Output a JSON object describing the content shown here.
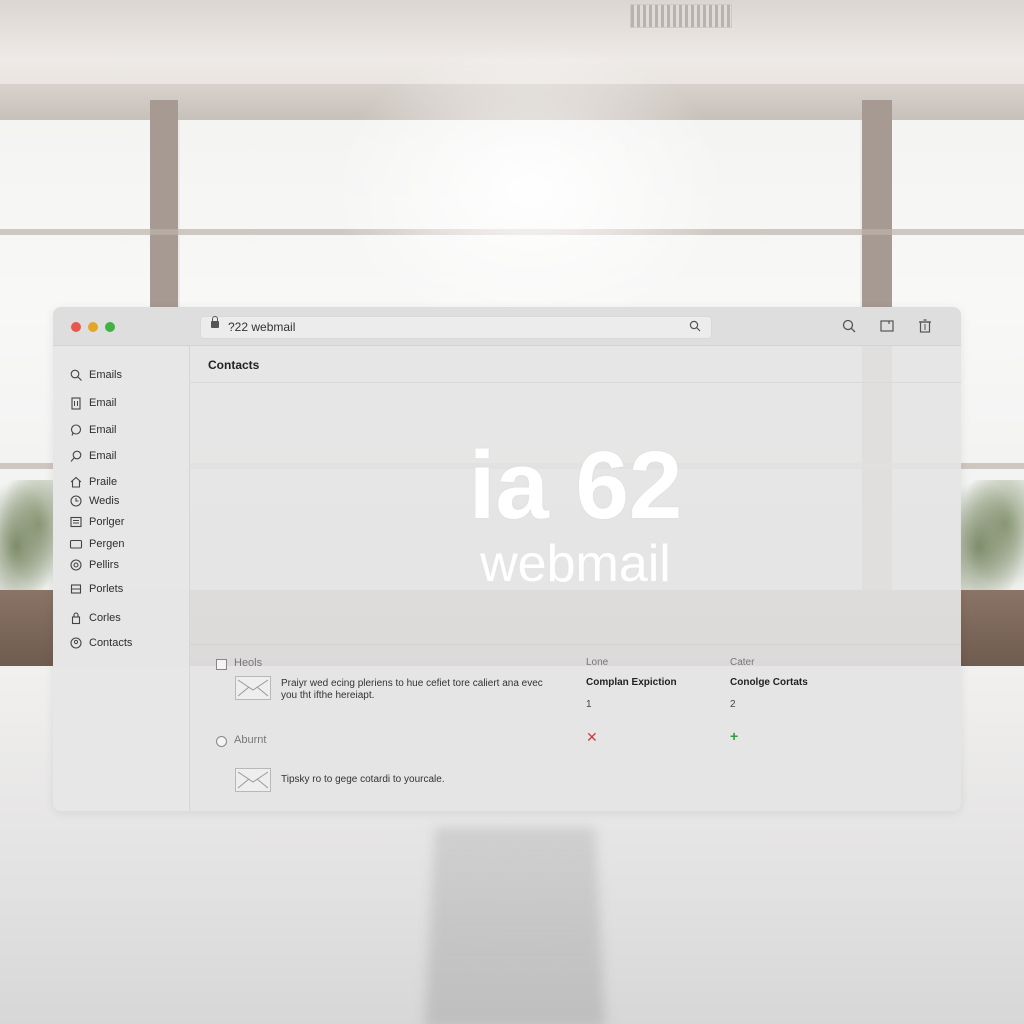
{
  "window": {
    "address": "?22 webmail",
    "controls": [
      "close",
      "minimize",
      "maximize"
    ],
    "toolbar_icons": [
      "search-icon",
      "window-icon",
      "trash-icon"
    ]
  },
  "sidebar": {
    "items": [
      {
        "label": "Emails",
        "icon": "search-icon"
      },
      {
        "label": "Email",
        "icon": "building-icon"
      },
      {
        "label": "Email",
        "icon": "chat-bubble-icon"
      },
      {
        "label": "Email",
        "icon": "pen-icon"
      },
      {
        "label": "Praile",
        "icon": "home-icon"
      },
      {
        "label": "Wedis",
        "icon": "clock-icon"
      },
      {
        "label": "Porlger",
        "icon": "document-icon"
      },
      {
        "label": "Pergen",
        "icon": "folder-icon"
      },
      {
        "label": "Pellirs",
        "icon": "at-icon"
      },
      {
        "label": "Porlets",
        "icon": "list-icon"
      },
      {
        "label": "Corles",
        "icon": "lock-icon"
      },
      {
        "label": "Contacts",
        "icon": "contacts-icon"
      }
    ]
  },
  "main": {
    "title": "Contacts",
    "brand_main": "ia 62",
    "brand_sub": "webmail",
    "columns": [
      {
        "header": "Lone",
        "title": "Complan Expiction",
        "number": "1",
        "status_icon": "x-icon"
      },
      {
        "header": "Cater",
        "title": "Conolge Cortats",
        "number": "2",
        "status_icon": "plus-icon"
      }
    ],
    "rows": [
      {
        "label": "Heols",
        "text": "Praiyr wed ecing pleriens to hue cefiet tore caliert ana evec you tht ifthe hereiapt."
      },
      {
        "label": "Aburnt",
        "text": "Tipsky ro to gege cotardi to yourcale."
      }
    ]
  },
  "colors": {
    "close": "#e8574c",
    "minimize": "#e3a727",
    "maximize": "#3db342",
    "error": "#d23b3b",
    "success": "#2e9c3e"
  }
}
